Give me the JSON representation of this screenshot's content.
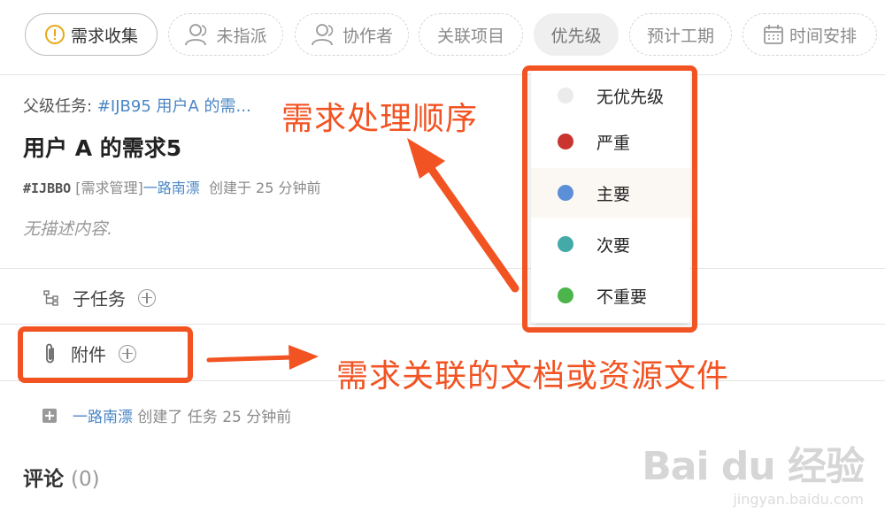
{
  "toolbar": {
    "status": {
      "label": "需求收集",
      "icon": "alert-circle-icon"
    },
    "assignee": {
      "label": "未指派",
      "icon": "person-icon"
    },
    "collaborators": {
      "label": "协作者",
      "icon": "person-icon"
    },
    "related_project": {
      "label": "关联项目"
    },
    "priority": {
      "label": "优先级"
    },
    "estimate": {
      "label": "预计工期"
    },
    "schedule": {
      "label": "时间安排",
      "icon": "calendar-icon"
    }
  },
  "task": {
    "parent_label": "父级任务:",
    "parent_link": "#IJB95 用户A 的需...",
    "title": "用户 A 的需求5",
    "ident": "#IJBBO",
    "category": "[需求管理]",
    "owner": "一路南漂",
    "created": "创建于 25 分钟前",
    "description": "无描述内容."
  },
  "sections": {
    "subtasks": {
      "label": "子任务",
      "icon": "tree-icon"
    },
    "attachments": {
      "label": "附件",
      "icon": "paperclip-icon"
    }
  },
  "activity": {
    "actor": "一路南漂",
    "text": "创建了 任务 25 分钟前"
  },
  "comments": {
    "label": "评论",
    "count": "(0)"
  },
  "priority_menu": [
    {
      "label": "无优先级",
      "color": "#ebebeb"
    },
    {
      "label": "严重",
      "color": "#c9342f"
    },
    {
      "label": "主要",
      "color": "#5b8fd8",
      "hover": true
    },
    {
      "label": "次要",
      "color": "#43aaa7"
    },
    {
      "label": "不重要",
      "color": "#4bb54b"
    }
  ],
  "annotations": {
    "priority_note": "需求处理顺序",
    "attachment_note": "需求关联的文档或资源文件",
    "color": "#f25322"
  },
  "watermark": {
    "brand": "Bai du 经验",
    "url": "jingyan.baidu.com"
  }
}
